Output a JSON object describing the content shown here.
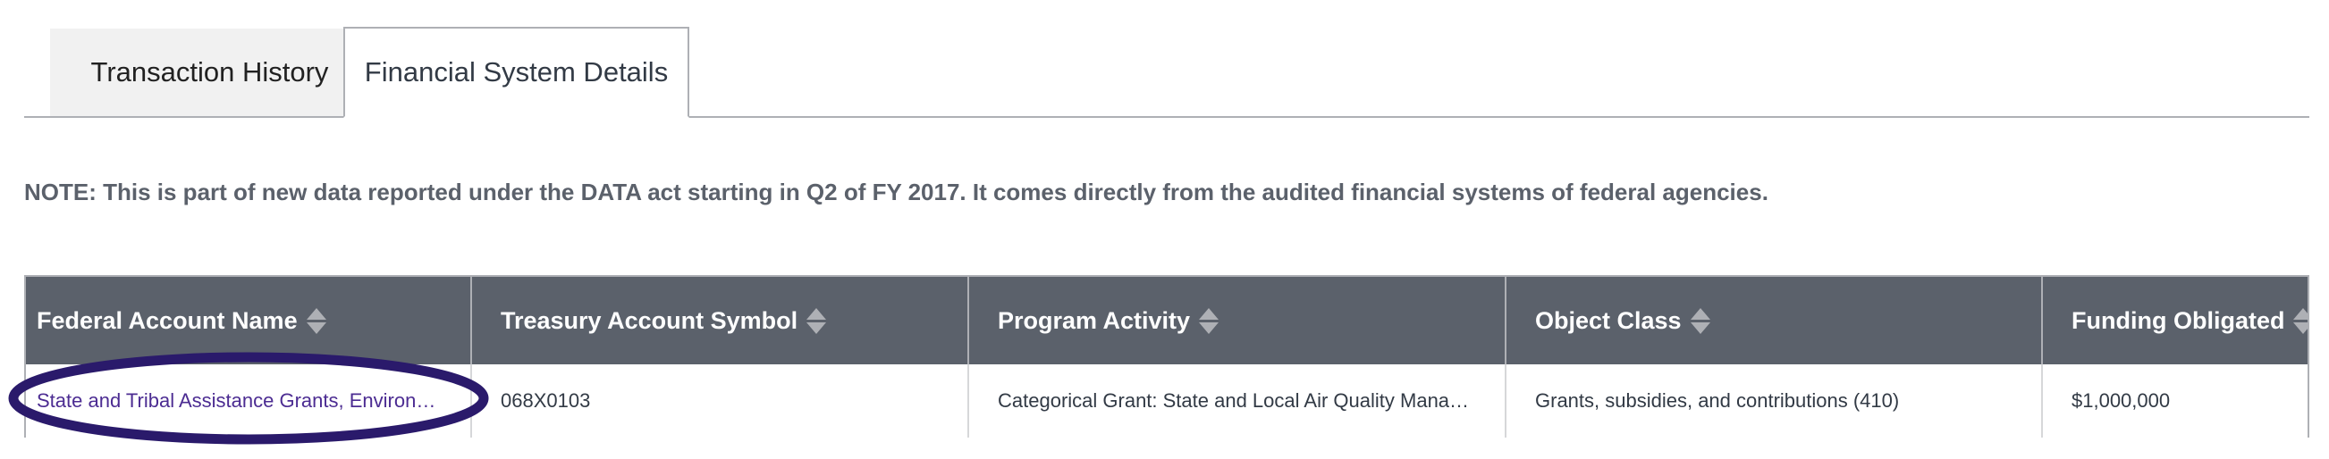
{
  "tabs": [
    {
      "label": "Transaction History",
      "active": false
    },
    {
      "label": "Financial System Details",
      "active": true
    }
  ],
  "note": "NOTE: This is part of new data reported under the DATA act starting in Q2 of FY 2017.  It comes directly from the audited financial systems of federal agencies.",
  "table": {
    "headers": [
      "Federal Account Name",
      "Treasury Account Symbol",
      "Program Activity",
      "Object Class",
      "Funding Obligated"
    ],
    "rows": [
      [
        "State and Tribal Assistance Grants, Environ…",
        "068X0103",
        "Categorical Grant: State and Local Air Quality Mana…",
        "Grants, subsidies, and contributions (410)",
        "$1,000,000"
      ]
    ]
  },
  "colors": {
    "header_bg": "#5b616b",
    "link": "#4c2c92",
    "highlight_ellipse": "#2a1a6b"
  }
}
